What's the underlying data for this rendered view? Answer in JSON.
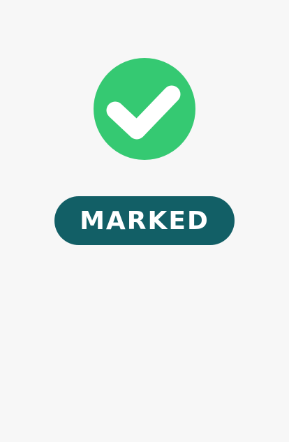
{
  "status": {
    "icon": "checkmark-icon",
    "label": "MARKED",
    "icon_color": "#35c972",
    "badge_color": "#125f66",
    "text_color": "#ffffff",
    "background_color": "#f7f7f7"
  }
}
